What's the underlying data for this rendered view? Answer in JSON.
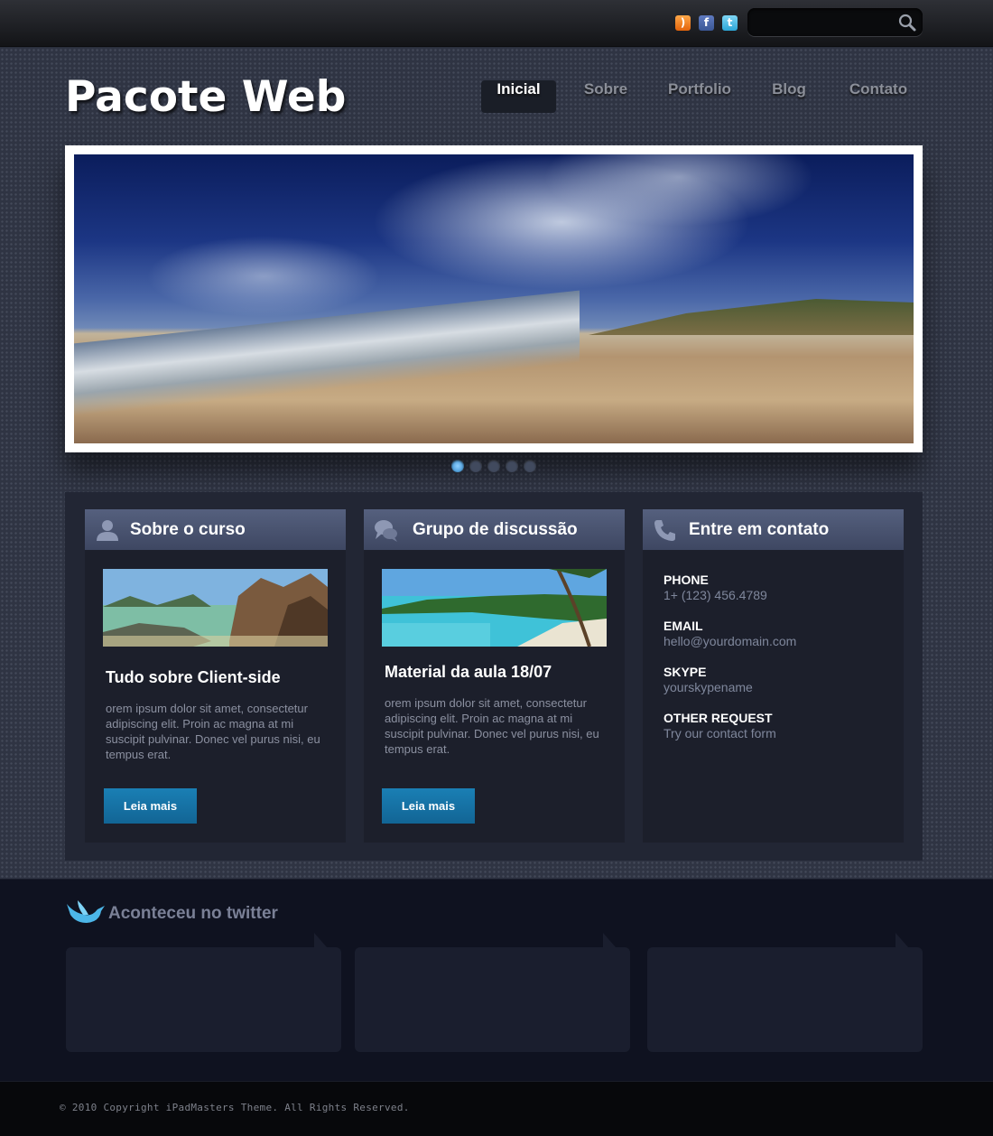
{
  "header": {
    "social_icons": [
      "rss-icon",
      "facebook-icon",
      "twitter-icon"
    ],
    "search": {
      "placeholder": "",
      "value": ""
    }
  },
  "site": {
    "logo": "Pacote Web"
  },
  "nav": {
    "items": [
      {
        "label": "Inicial",
        "active": true
      },
      {
        "label": "Sobre",
        "active": false
      },
      {
        "label": "Portfolio",
        "active": false
      },
      {
        "label": "Blog",
        "active": false
      },
      {
        "label": "Contato",
        "active": false
      }
    ]
  },
  "slider": {
    "slides": 5,
    "active_slide": 1
  },
  "columns": [
    {
      "heading": "Sobre o curso",
      "icon": "user-icon",
      "title": "Tudo sobre Client-side",
      "text": "orem ipsum dolor sit amet, consectetur adipiscing elit. Proin ac magna at mi suscipit pulvinar. Donec vel purus nisi, eu tempus erat.",
      "button": "Leia mais"
    },
    {
      "heading": "Grupo de discussão",
      "icon": "chat-bubbles-icon",
      "title": "Material da aula 18/07",
      "text": "orem ipsum dolor sit amet, consectetur adipiscing elit. Proin ac magna at mi suscipit pulvinar. Donec vel purus nisi, eu tempus erat.",
      "button": "Leia mais"
    },
    {
      "heading": "Entre em contato",
      "icon": "phone-icon",
      "contact": [
        {
          "label": "PHONE",
          "value": "1+ (123) 456.4789"
        },
        {
          "label": "EMAIL",
          "value": "hello@yourdomain.com"
        },
        {
          "label": "SKYPE",
          "value": "yourskypename"
        },
        {
          "label": "OTHER REQUEST",
          "value": "Try our contact form"
        }
      ]
    }
  ],
  "twitter": {
    "title": "Aconteceu no twitter"
  },
  "footer": {
    "copyright": "© 2010 Copyright iPadMasters Theme. All Rights Reserved."
  },
  "colors": {
    "accent_button": "#1a7fb4",
    "active_dot": "#2b82c5",
    "header_bar": "#4a5470"
  }
}
